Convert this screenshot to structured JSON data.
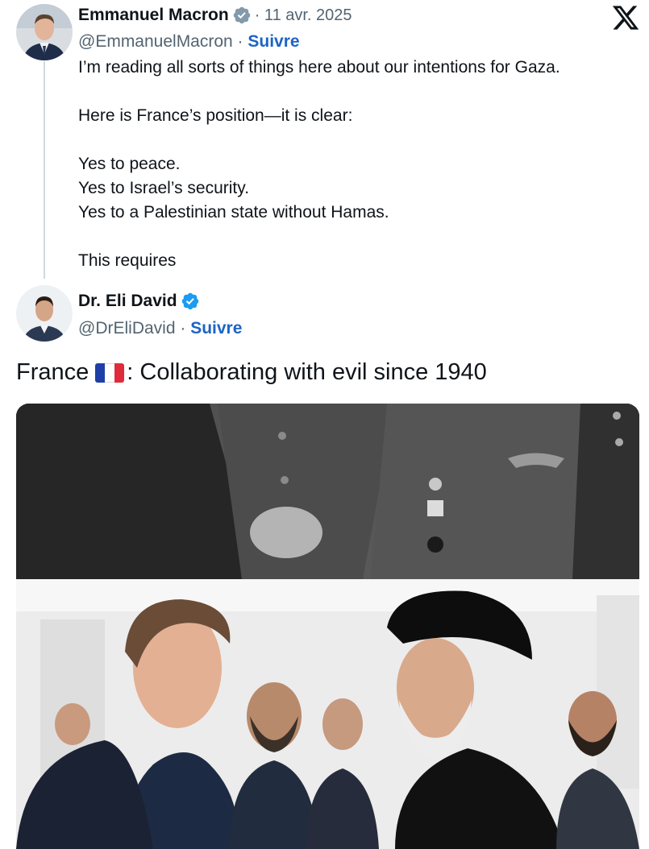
{
  "tweet1": {
    "name": "Emmanuel Macron",
    "handle": "@EmmanuelMacron",
    "date": "· 11 avr. 2025",
    "follow_label": "Suivre",
    "separator": " · ",
    "lines": [
      "I’m reading all sorts of things here about our intentions for Gaza.",
      "",
      "Here is France’s position—it is clear:",
      "",
      "Yes to peace.",
      "Yes to Israel’s security.",
      "Yes to a Palestinian state without Hamas.",
      "",
      "This requires"
    ]
  },
  "tweet2": {
    "name": "Dr. Eli David",
    "handle": "@DrEliDavid",
    "follow_label": "Suivre",
    "separator": " · ",
    "text_before_flag": "France",
    "text_after_flag": ": Collaborating with evil since 1940"
  },
  "colors": {
    "follow": "#1d64c4",
    "badge_gray": "#829aab",
    "badge_blue": "#1d9bf0",
    "text": "#0f1419",
    "secondary": "#536471"
  },
  "icons": {
    "logo": "x-logo-icon",
    "verified_gray": "verified-badge-gray-icon",
    "verified_blue": "verified-badge-blue-icon",
    "flag": "france-flag-emoji"
  }
}
